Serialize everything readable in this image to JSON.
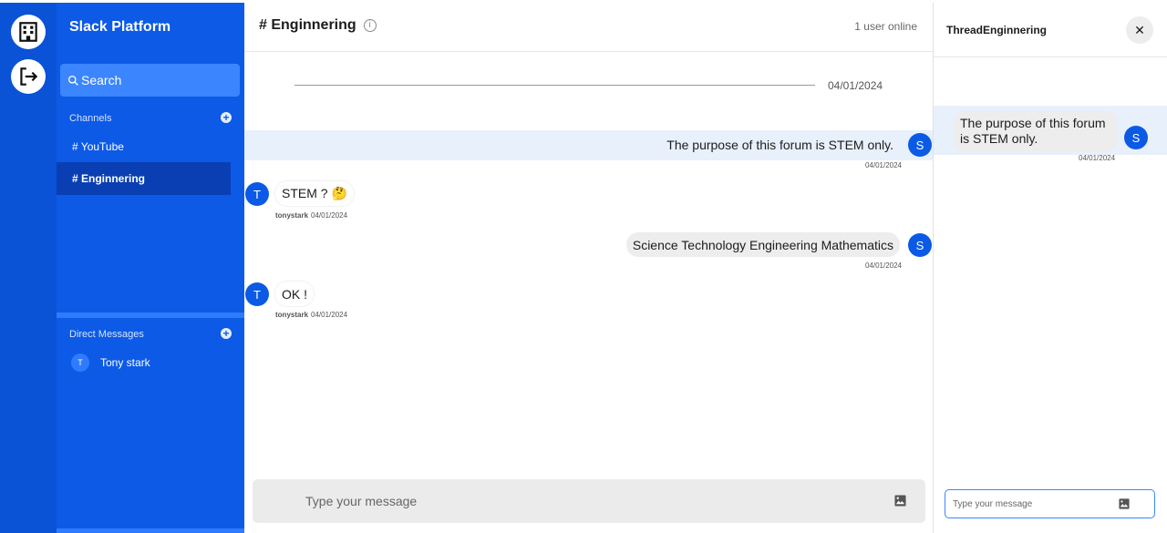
{
  "rail": {
    "items": [
      {
        "icon": "building-icon"
      },
      {
        "icon": "logout-icon"
      }
    ]
  },
  "sidebar": {
    "workspace_title": "Slack Platform",
    "search_placeholder": "Search",
    "channels_label": "Channels",
    "channels": [
      {
        "label": "# YouTube",
        "active": false
      },
      {
        "label": "# Enginnering",
        "active": true
      }
    ],
    "dm_label": "Direct Messages",
    "dms": [
      {
        "initial": "T",
        "name": "Tony stark"
      }
    ]
  },
  "main": {
    "channel_title": "# Enginnering",
    "online_status": "1 user online",
    "date_divider": "04/01/2024",
    "messages": [
      {
        "direction": "out",
        "avatar": "S",
        "text": "The purpose of this forum is STEM only.",
        "user": "",
        "date": "04/01/2024",
        "highlighted": true
      },
      {
        "direction": "in",
        "avatar": "T",
        "text": "STEM ? 🤔",
        "user": "tonystark",
        "date": "04/01/2024"
      },
      {
        "direction": "out",
        "avatar": "S",
        "text": "Science Technology Engineering Mathematics",
        "user": "",
        "date": "04/01/2024"
      },
      {
        "direction": "in",
        "avatar": "T",
        "text": "OK !",
        "user": "tonystark",
        "date": "04/01/2024"
      }
    ],
    "composer_placeholder": "Type your message"
  },
  "thread": {
    "title": "ThreadEnginnering",
    "close_label": "✕",
    "message": {
      "avatar": "S",
      "text": "The purpose of this forum is STEM only.",
      "date": "04/01/2024"
    },
    "composer_placeholder": "Type your message"
  },
  "colors": {
    "sidebar": "#0c5ae6",
    "rail": "#0a52d6",
    "accent": "#0b5ae6",
    "highlight": "#e8f0fc"
  }
}
